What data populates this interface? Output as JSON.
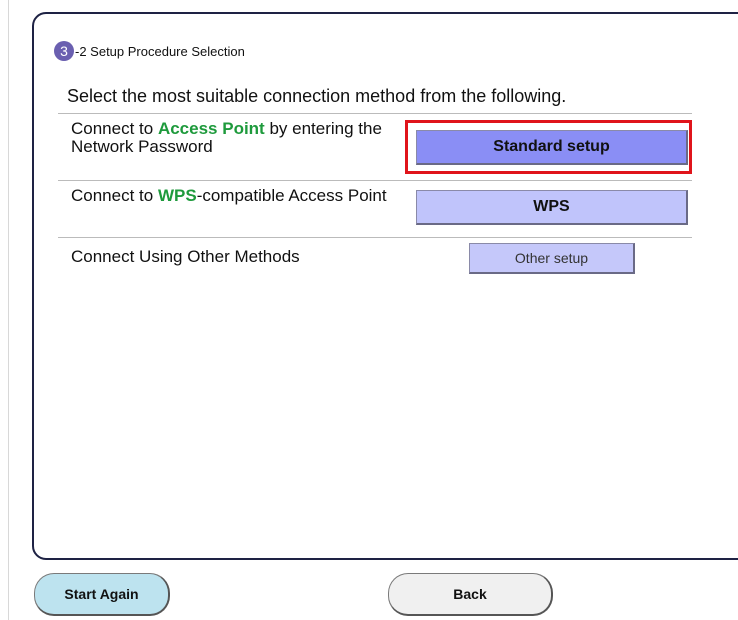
{
  "step": {
    "number": "3",
    "title": "-2 Setup Procedure Selection"
  },
  "instruction": "Select the most suitable connection method from the following.",
  "options": [
    {
      "label_prefix": "Connect to ",
      "label_highlight": "Access Point",
      "label_suffix": " by entering the Network Password",
      "button_label": "Standard setup",
      "highlighted": true
    },
    {
      "label_prefix": "Connect to ",
      "label_highlight": "WPS",
      "label_suffix": "-compatible Access Point",
      "button_label": "WPS"
    },
    {
      "label_prefix": "Connect Using Other Methods",
      "button_label": "Other setup"
    }
  ],
  "footer": {
    "start_again_label": "Start Again",
    "back_label": "Back"
  },
  "colors": {
    "highlight_text": "#1e9a3c",
    "highlight_frame": "#e0141b",
    "step_badge": "#6a5fb0",
    "standard_button": "#8a8ef5",
    "wps_button": "#c0c4fb",
    "other_button": "#c5c8fa",
    "start_again_button": "#bde3ef",
    "back_button": "#f0f0f0",
    "panel_border": "#1e2244"
  }
}
